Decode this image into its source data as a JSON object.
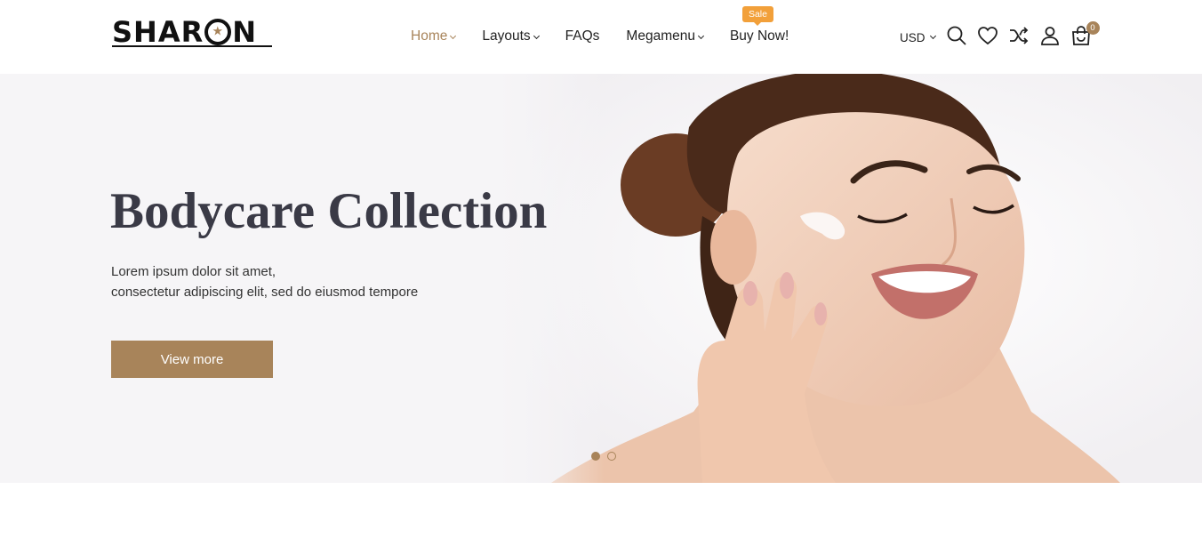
{
  "brand": {
    "logo_text": "SHARON"
  },
  "nav": [
    {
      "label": "Home",
      "dropdown": true,
      "active": true
    },
    {
      "label": "Layouts",
      "dropdown": true
    },
    {
      "label": "FAQs",
      "dropdown": false
    },
    {
      "label": "Megamenu",
      "dropdown": true
    },
    {
      "label": "Buy Now!",
      "dropdown": false,
      "badge": "Sale"
    }
  ],
  "tools": {
    "currency": "USD",
    "icons": [
      "search-icon",
      "heart-icon",
      "shuffle-icon",
      "user-icon",
      "cart-icon"
    ],
    "cart_count": "0"
  },
  "hero": {
    "title": "Bodycare Collection",
    "desc_line1": "Lorem ipsum dolor sit amet,",
    "desc_line2": "consectetur adipiscing elit, sed do eiusmod tempore",
    "button_label": "View more",
    "slides": 2,
    "active_slide": 1
  },
  "colors": {
    "accent": "#a8845a",
    "sale_badge": "#f2a03a",
    "hero_bg": "#f6f5f7"
  }
}
